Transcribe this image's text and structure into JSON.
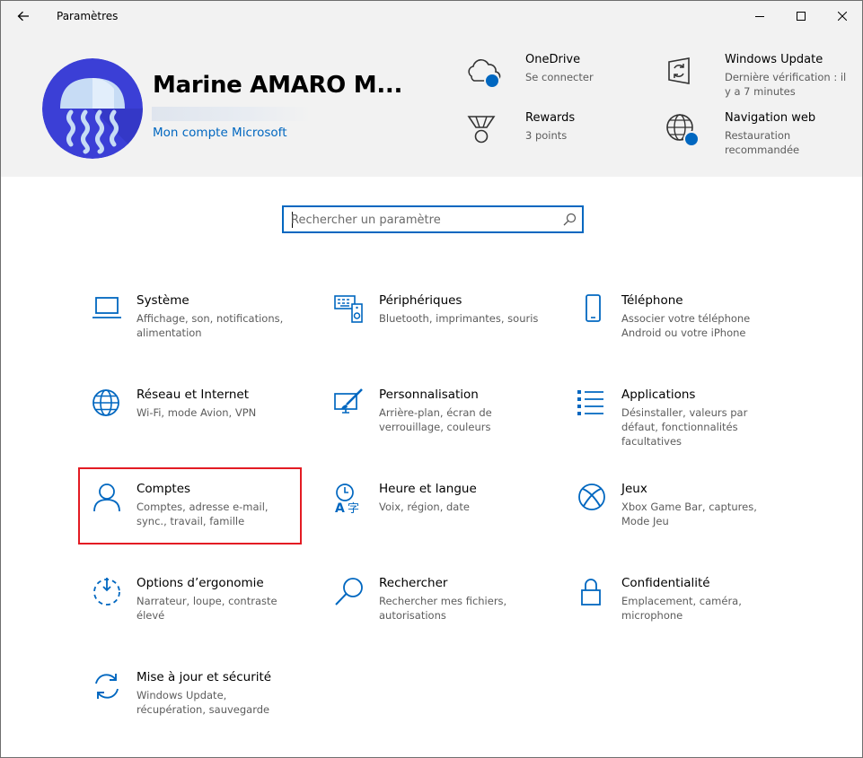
{
  "window": {
    "title": "Paramètres"
  },
  "header": {
    "user_name": "Marine AMARO M...",
    "account_link": "Mon compte Microsoft",
    "status_items": [
      {
        "title": "OneDrive",
        "subtitle": "Se connecter",
        "icon": "onedrive-cloud-icon"
      },
      {
        "title": "Windows Update",
        "subtitle": "Dernière vérification : il y a 7 minutes",
        "icon": "windows-update-icon"
      },
      {
        "title": "Rewards",
        "subtitle": "3 points",
        "icon": "rewards-medal-icon"
      },
      {
        "title": "Navigation web",
        "subtitle": "Restauration recommandée",
        "icon": "globe-icon"
      }
    ]
  },
  "search": {
    "placeholder": "Rechercher un paramètre"
  },
  "categories": [
    {
      "title": "Système",
      "description": "Affichage, son, notifications, alimentation",
      "icon": "laptop-icon"
    },
    {
      "title": "Périphériques",
      "description": "Bluetooth, imprimantes, souris",
      "icon": "devices-icon"
    },
    {
      "title": "Téléphone",
      "description": "Associer votre téléphone Android ou votre iPhone",
      "icon": "phone-icon"
    },
    {
      "title": "Réseau et Internet",
      "description": "Wi-Fi, mode Avion, VPN",
      "icon": "globe-icon"
    },
    {
      "title": "Personnalisation",
      "description": "Arrière-plan, écran de verrouillage, couleurs",
      "icon": "paint-brush-icon"
    },
    {
      "title": "Applications",
      "description": "Désinstaller, valeurs par défaut, fonctionnalités facultatives",
      "icon": "apps-list-icon"
    },
    {
      "title": "Comptes",
      "description": "Comptes, adresse e-mail, sync., travail, famille",
      "icon": "person-icon"
    },
    {
      "title": "Heure et langue",
      "description": "Voix, région, date",
      "icon": "time-language-icon"
    },
    {
      "title": "Jeux",
      "description": "Xbox Game Bar, captures, Mode Jeu",
      "icon": "xbox-icon"
    },
    {
      "title": "Options d’ergonomie",
      "description": "Narrateur, loupe, contraste élevé",
      "icon": "ease-of-access-icon"
    },
    {
      "title": "Rechercher",
      "description": "Rechercher mes fichiers, autorisations",
      "icon": "magnifier-icon"
    },
    {
      "title": "Confidentialité",
      "description": "Emplacement, caméra, microphone",
      "icon": "padlock-icon"
    },
    {
      "title": "Mise à jour et sécurité",
      "description": "Windows Update, récupération, sauvegarde",
      "icon": "sync-arrows-icon"
    }
  ],
  "colors": {
    "accent": "#0067c0",
    "header_bg": "#f2f2f2",
    "highlight": "#e31b23",
    "avatar_bg": "#3b3fd6"
  }
}
